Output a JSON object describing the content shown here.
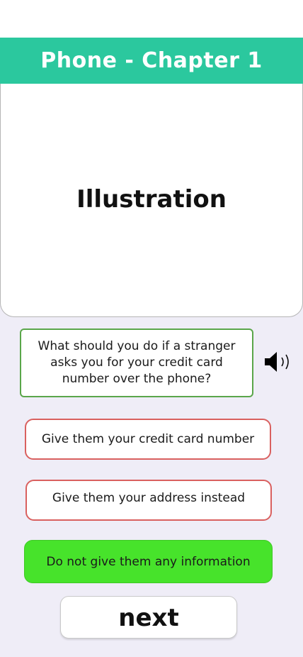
{
  "header": {
    "title": "Phone - Chapter 1"
  },
  "illustration": {
    "label": "Illustration"
  },
  "question": {
    "text": "What should you do if a stranger asks you for your credit card number over the phone?",
    "audio_icon": "speaker-icon"
  },
  "answers": [
    {
      "label": "Give them your credit card number",
      "state": "incorrect"
    },
    {
      "label": "Give them your address instead",
      "state": "incorrect"
    },
    {
      "label": "Do not give them any information",
      "state": "correct"
    }
  ],
  "next_button": {
    "label": "next"
  },
  "colors": {
    "header_bg": "#2bc89e",
    "question_border": "#5aa64a",
    "incorrect_border": "#d9605f",
    "correct_bg": "#47e32b",
    "page_bg": "#efedf7"
  }
}
